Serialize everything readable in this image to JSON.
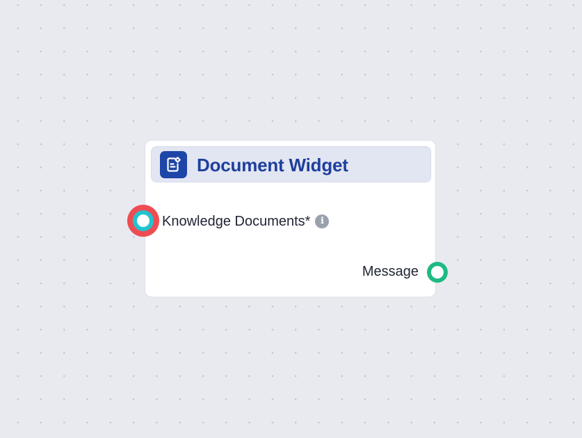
{
  "node": {
    "title": "Document Widget",
    "icon": "document-edit-icon",
    "inputs": [
      {
        "label": "Knowledge Documents*",
        "info_icon": "i"
      }
    ],
    "outputs": [
      {
        "label": "Message"
      }
    ]
  },
  "colors": {
    "canvas_background": "#e9eaf0",
    "header_background": "#e2e6f2",
    "title_color": "#1e3f9c",
    "icon_background": "#1e45a8",
    "input_handle_outer": "#ee4c53",
    "input_handle_ring": "#22c3cf",
    "output_handle": "#1fba84"
  }
}
